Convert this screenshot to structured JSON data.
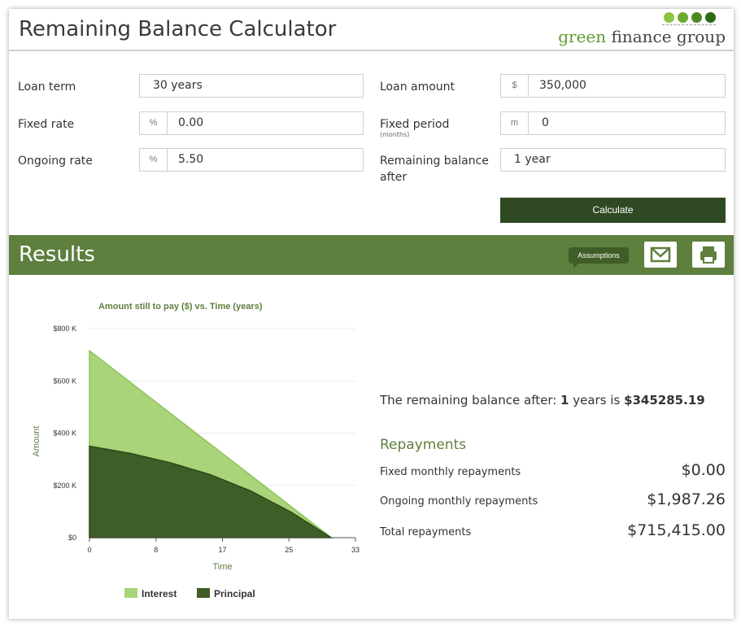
{
  "header": {
    "title": "Remaining Balance Calculator",
    "logo_green": "green",
    "logo_rest": " finance group",
    "dot_colors": [
      "#8cc63f",
      "#6aaa2e",
      "#4d8a22",
      "#2f6a15"
    ]
  },
  "form": {
    "loan_term": {
      "label": "Loan term",
      "value": "30 years"
    },
    "fixed_rate": {
      "label": "Fixed rate",
      "prefix": "%",
      "value": "0.00"
    },
    "ongoing_rate": {
      "label": "Ongoing rate",
      "prefix": "%",
      "value": "5.50"
    },
    "loan_amount": {
      "label": "Loan amount",
      "prefix": "$",
      "value": "350,000"
    },
    "fixed_period": {
      "label": "Fixed period",
      "sublabel": "(months)",
      "prefix": "m",
      "value": "0"
    },
    "remaining_after": {
      "label_line1": "Remaining balance",
      "label_line2": "after",
      "value": "1 year"
    },
    "calculate_label": "Calculate"
  },
  "results": {
    "title": "Results",
    "assumptions_label": "Assumptions",
    "email_icon": "email-icon",
    "print_icon": "print-icon",
    "summary_prefix": "The remaining balance after: ",
    "summary_years": "1",
    "summary_middle": " years is ",
    "summary_amount": "$345285.19",
    "repayments_heading": "Repayments",
    "rows": [
      {
        "label": "Fixed monthly repayments",
        "value": "$0.00"
      },
      {
        "label": "Ongoing monthly repayments",
        "value": "$1,987.26"
      },
      {
        "label": "Total repayments",
        "value": "$715,415.00"
      }
    ]
  },
  "chart_data": {
    "type": "area",
    "title": "Amount still to pay ($) vs. Time (years)",
    "xlabel": "Time",
    "ylabel": "Amount",
    "xlim": [
      0,
      33
    ],
    "ylim": [
      0,
      800000
    ],
    "x_ticks": [
      "0",
      "8",
      "17",
      "25",
      "33"
    ],
    "y_ticks": [
      "$0",
      "$200 K",
      "$400 K",
      "$600 K",
      "$800 K"
    ],
    "series": [
      {
        "name": "Interest",
        "color": "#a9d47a",
        "x": [
          0,
          5,
          10,
          15,
          20,
          25,
          30
        ],
        "values": [
          715415,
          596179,
          476943,
          357708,
          238472,
          119236,
          0
        ]
      },
      {
        "name": "Principal",
        "color": "#3f5d26",
        "x": [
          0,
          5,
          10,
          15,
          20,
          25,
          30
        ],
        "values": [
          350000,
          323000,
          287000,
          241000,
          179000,
          98000,
          0
        ]
      }
    ],
    "legend_position": "bottom",
    "grid": true
  }
}
